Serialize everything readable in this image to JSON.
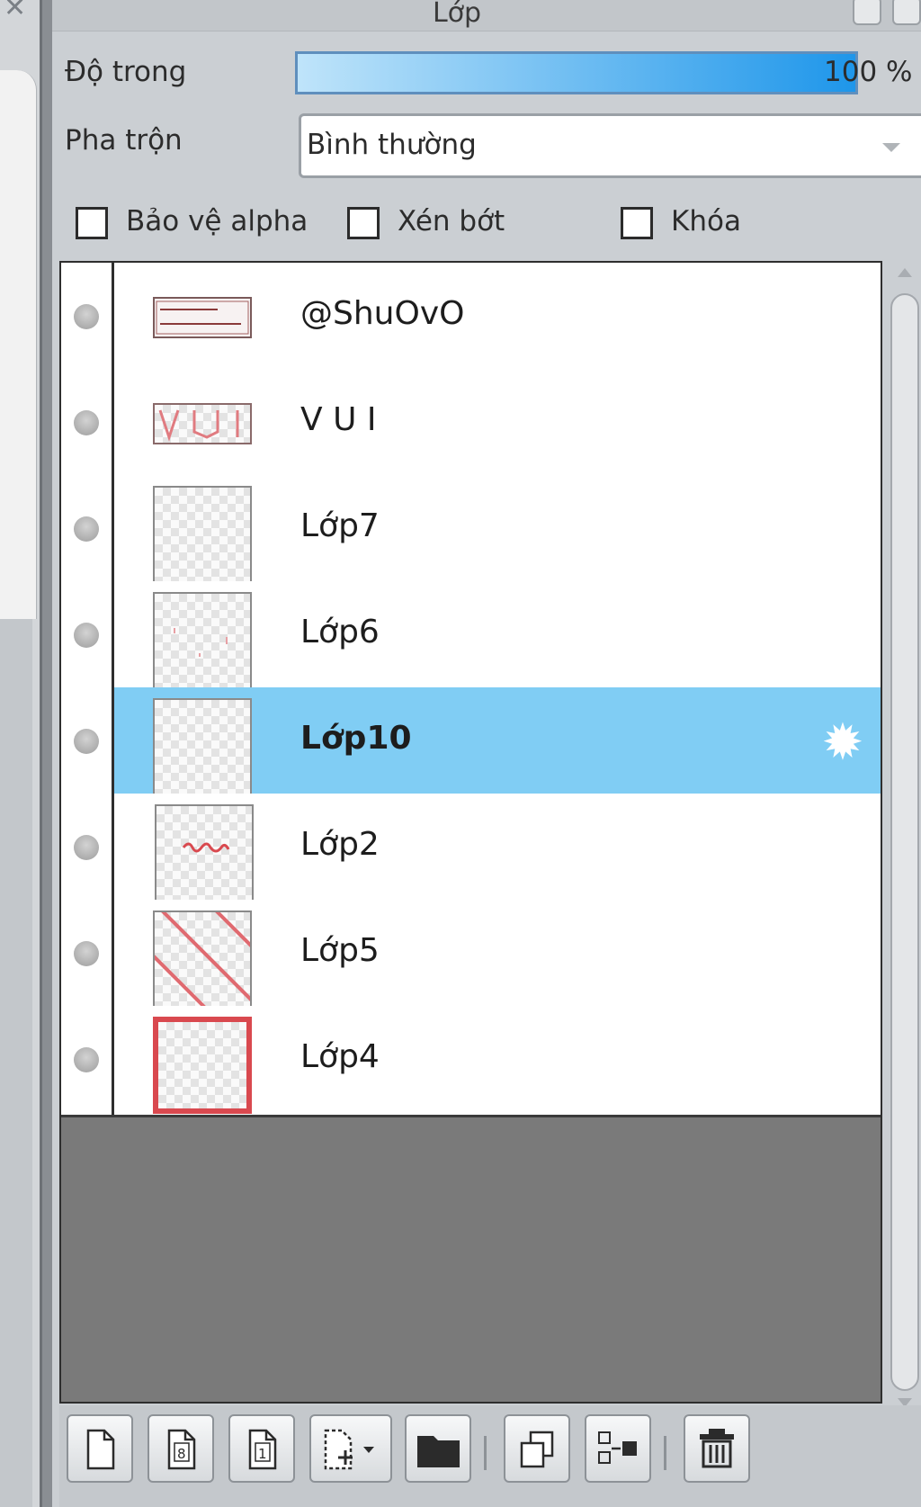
{
  "panel": {
    "title": "Lớp",
    "opacity": {
      "label": "Độ trong",
      "value": 100,
      "value_text": "100 %"
    },
    "blend": {
      "label": "Pha trộn",
      "selected": "Bình thường"
    },
    "checkboxes": [
      {
        "label": "Bảo vệ alpha",
        "checked": false
      },
      {
        "label": "Xén bớt",
        "checked": false
      },
      {
        "label": "Khóa",
        "checked": false
      }
    ],
    "layers": [
      {
        "name": "@ShuOvO",
        "thumb_text": "@ShuOvO #Hutlap24Y",
        "selected": false
      },
      {
        "name": "V U I",
        "thumb_text": "V U I",
        "selected": false
      },
      {
        "name": "Lớp7",
        "selected": false
      },
      {
        "name": "Lớp6",
        "selected": false
      },
      {
        "name": "Lớp10",
        "selected": true
      },
      {
        "name": "Lớp2",
        "selected": false
      },
      {
        "name": "Lớp5",
        "selected": false
      },
      {
        "name": "Lớp4",
        "selected": false
      }
    ],
    "toolbar_icons": [
      "new-layer-icon",
      "new-8bit-layer-icon",
      "new-1bit-layer-icon",
      "new-layer-menu-icon",
      "new-folder-icon",
      "duplicate-layer-icon",
      "merge-layer-icon",
      "delete-layer-icon"
    ],
    "colors": {
      "selected_row": "#80cdf4",
      "accent_blue": "#1e96ea",
      "thumb_red": "#d9494f"
    }
  }
}
